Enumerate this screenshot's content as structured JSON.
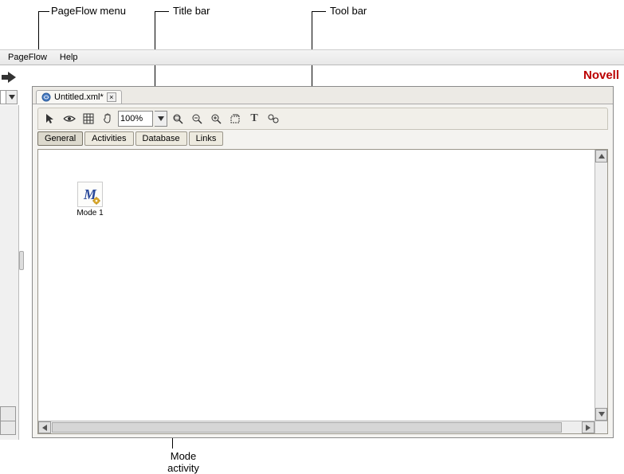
{
  "annotations": {
    "pageflow_menu": "PageFlow menu",
    "title_bar": "Title bar",
    "tool_bar": "Tool bar",
    "mode_activity": "Mode activity"
  },
  "menubar": {
    "items": [
      "PageFlow",
      "Help"
    ]
  },
  "brand": "Novell",
  "tab": {
    "title": "Untitled.xml*",
    "close_x": "×"
  },
  "toolbar": {
    "icons": [
      "pointer-icon",
      "eye-icon",
      "grid-icon",
      "hand-icon"
    ],
    "zoom_value": "100%",
    "icons_right": [
      "zoom-to-fit-icon",
      "zoom-out-icon",
      "zoom-in-icon",
      "select-all-icon",
      "text-tool-icon",
      "find-icon"
    ]
  },
  "palette_tabs": [
    "General",
    "Activities",
    "Database",
    "Links"
  ],
  "active_palette_tab": 0,
  "canvas": {
    "node": {
      "label": "Mode 1",
      "letter": "M"
    }
  }
}
